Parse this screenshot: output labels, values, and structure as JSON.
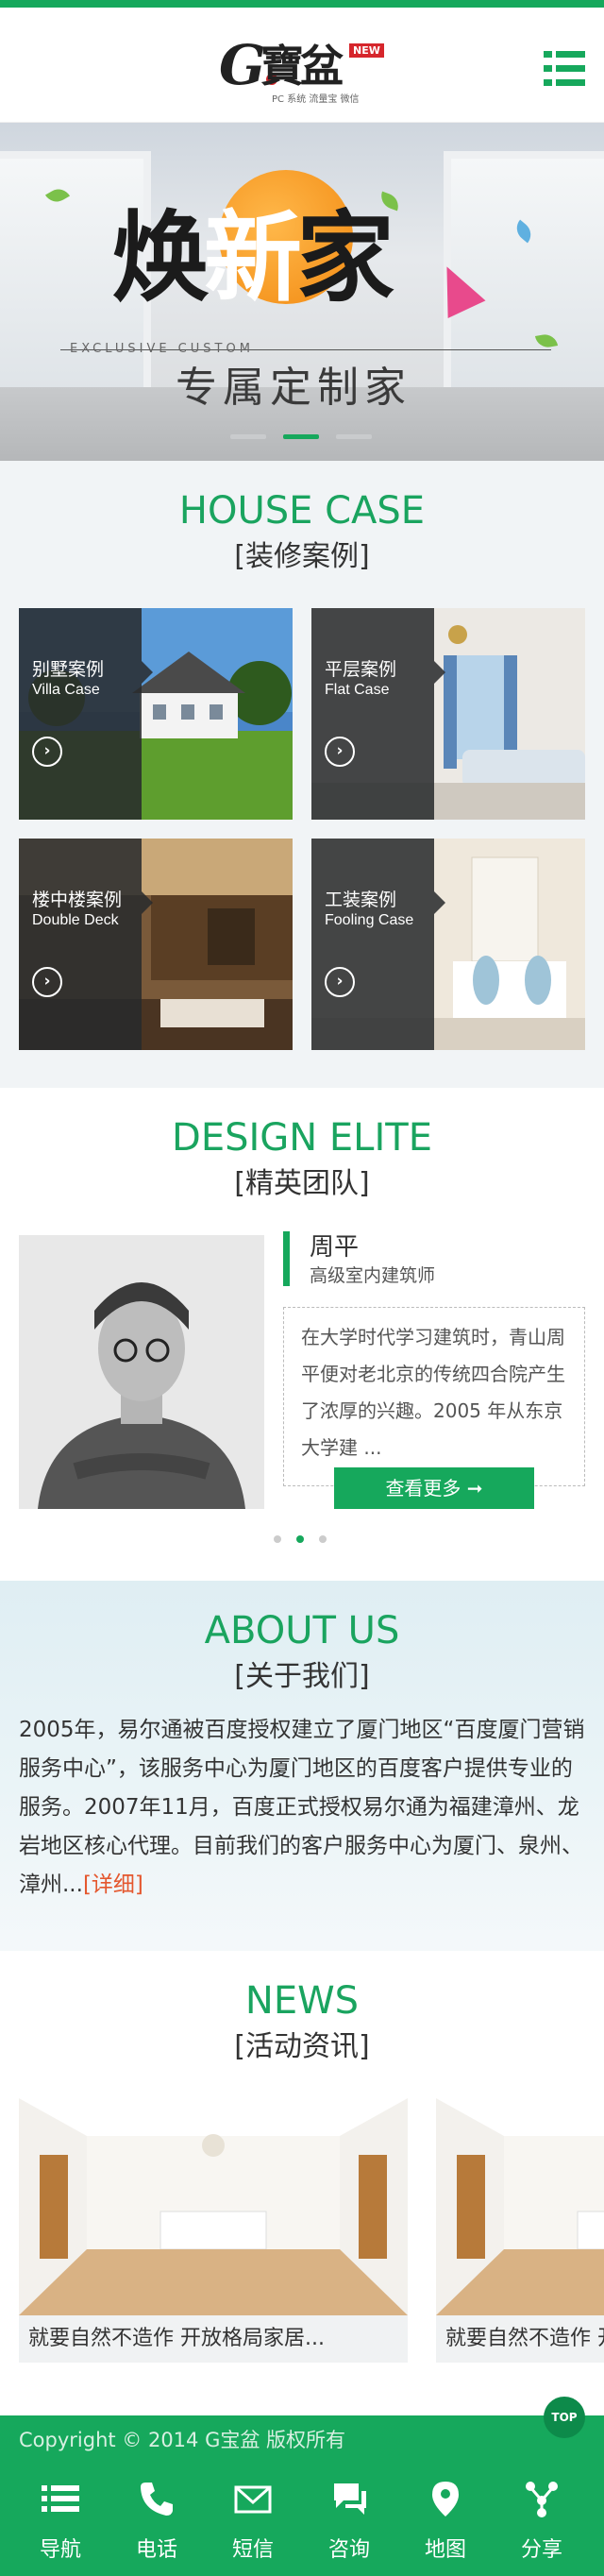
{
  "header": {
    "logo": {
      "letter": "G",
      "name": "寶盆",
      "badge": "NEW",
      "tagline": "PC 系统  流量宝  微信"
    },
    "menu_icon": "menu-icon"
  },
  "banner": {
    "title_left": "焕",
    "title_mid": "新",
    "title_right": "家",
    "subtitle_en": "EXCLUSIVE CUSTOM",
    "subtitle": "专属定制家",
    "slides": 3,
    "active_slide": 2
  },
  "house_case": {
    "title_en": "HOUSE CASE",
    "title_cn": "[装修案例]",
    "cards": [
      {
        "cn": "别墅案例",
        "en": "Villa Case"
      },
      {
        "cn": "平层案例",
        "en": "Flat Case"
      },
      {
        "cn": "楼中楼案例",
        "en": "Double Deck"
      },
      {
        "cn": "工装案例",
        "en": "Fooling Case"
      }
    ],
    "go_icon": "chevron-right-circle-icon"
  },
  "design_elite": {
    "title_en": "DESIGN ELITE",
    "title_cn": "[精英团队]",
    "name": "周平",
    "role": "高级室内建筑师",
    "bio": "在大学时代学习建筑时，青山周平便对老北京的传统四合院产生了浓厚的兴趣。2005 年从东京大学建 ...",
    "button": "查看更多 ➞",
    "pages": 3,
    "active_page": 2
  },
  "about": {
    "title_en": "ABOUT US",
    "title_cn": "[关于我们]",
    "text": "2005年，易尔通被百度授权建立了厦门地区“百度厦门营销服务中心”，该服务中心为厦门地区的百度客户提供专业的服务。2007年11月，百度正式授权易尔通为福建漳州、龙岩地区核心代理。目前我们的客户服务中心为厦门、泉州、漳州...",
    "more": "[详细]"
  },
  "news": {
    "title_en": "NEWS",
    "title_cn": "[活动资讯]",
    "items": [
      {
        "caption": "就要自然不造作 开放格局家居..."
      },
      {
        "caption": "就要自然不造作 开放格局家居..."
      }
    ]
  },
  "footer": {
    "copyright": "Copyright © 2014 G宝盆 版权所有",
    "top": "TOP",
    "tabs": [
      {
        "label": "导航",
        "icon": "list-icon"
      },
      {
        "label": "电话",
        "icon": "phone-icon"
      },
      {
        "label": "短信",
        "icon": "envelope-icon"
      },
      {
        "label": "咨询",
        "icon": "chat-icon"
      },
      {
        "label": "地图",
        "icon": "map-pin-icon"
      },
      {
        "label": "分享",
        "icon": "share-icon"
      }
    ]
  },
  "colors": {
    "accent": "#16a85c",
    "link": "#e4572e",
    "badge": "#d6262c"
  }
}
